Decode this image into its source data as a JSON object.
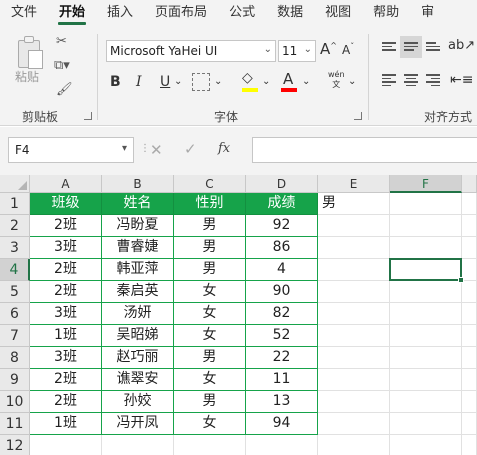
{
  "tabs": [
    "文件",
    "开始",
    "插入",
    "页面布局",
    "公式",
    "数据",
    "视图",
    "帮助",
    "审"
  ],
  "ribbon": {
    "clipboard": {
      "label": "剪贴板",
      "paste_label": "粘贴"
    },
    "font": {
      "label": "字体",
      "font_name": "Microsoft YaHei UI",
      "font_size": "11",
      "bold": "B",
      "italic": "I",
      "underline": "U",
      "grow": "A",
      "shrink": "A",
      "phonetic": "wén\n文"
    },
    "alignment": {
      "label": "对齐方式"
    },
    "highlight_color": "#ffff00",
    "font_color": "#ff0000"
  },
  "formula_bar": {
    "name_box": "F4",
    "formula": "",
    "fx": "fx"
  },
  "columns": [
    "A",
    "B",
    "C",
    "D",
    "E",
    "F"
  ],
  "rows": [
    "1",
    "2",
    "3",
    "4",
    "5",
    "6",
    "7",
    "8",
    "9",
    "10",
    "11",
    "12"
  ],
  "table": {
    "headers": [
      "班级",
      "姓名",
      "性别",
      "成绩"
    ],
    "rows": [
      [
        "2班",
        "冯盼夏",
        "男",
        "92"
      ],
      [
        "3班",
        "曹睿婕",
        "男",
        "86"
      ],
      [
        "2班",
        "韩亚萍",
        "男",
        "4"
      ],
      [
        "2班",
        "秦启英",
        "女",
        "90"
      ],
      [
        "3班",
        "汤妍",
        "女",
        "82"
      ],
      [
        "1班",
        "吴昭娣",
        "女",
        "52"
      ],
      [
        "3班",
        "赵巧丽",
        "男",
        "22"
      ],
      [
        "2班",
        "谯翠安",
        "女",
        "11"
      ],
      [
        "2班",
        "孙姣",
        "男",
        "13"
      ],
      [
        "1班",
        "冯开凤",
        "女",
        "94"
      ]
    ]
  },
  "e1_value": "男",
  "active_cell": "F4",
  "accent_color": "#217346",
  "header_fill": "#16a34a"
}
